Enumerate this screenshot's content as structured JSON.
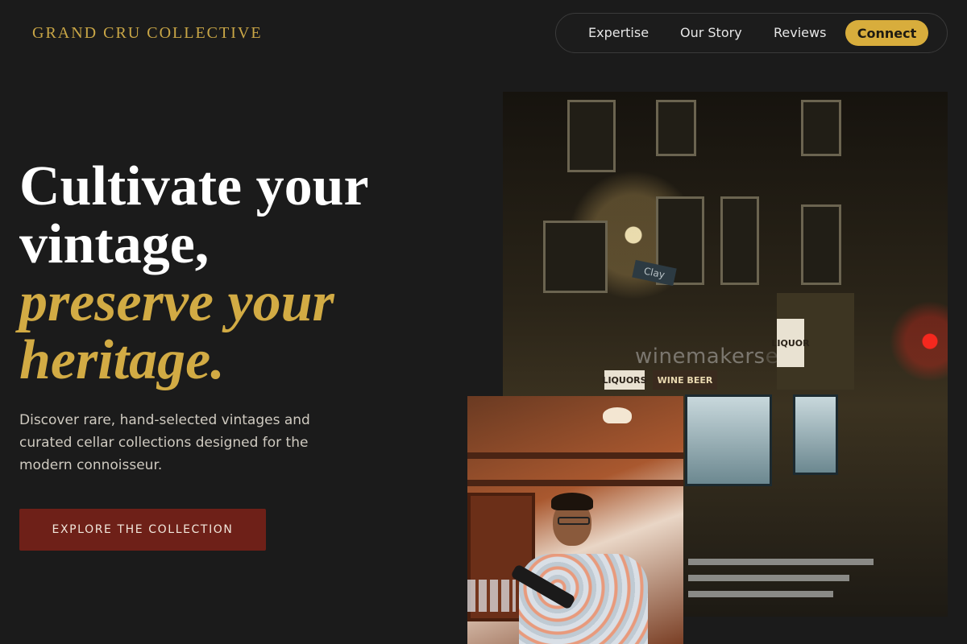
{
  "brand": {
    "name": "GRAND CRU COLLECTIVE"
  },
  "nav": {
    "items": [
      "Expertise",
      "Our Story",
      "Reviews"
    ],
    "cta": "Connect"
  },
  "hero": {
    "headline_plain": [
      "Cultivate your",
      "vintage,"
    ],
    "headline_accent": [
      "preserve your",
      "heritage."
    ],
    "description": "Discover rare, hand-selected vintages and curated cellar collections designed for the modern connoisseur.",
    "cta_label": "EXPLORE THE COLLECTION"
  },
  "photos": {
    "street_signs": {
      "street": "Clay",
      "liquor_left": "LIQUORS",
      "wine_beer": "WINE BEER",
      "liquor_corner": "LIQUOR"
    },
    "watermark": "winemakers",
    "watermark_faint": "e"
  },
  "colors": {
    "background": "#1b1b1b",
    "brand_gold": "#c9a646",
    "accent_gold": "#d2ab44",
    "connect_gold": "#d8ad3c",
    "cta_red": "#6e2018"
  }
}
